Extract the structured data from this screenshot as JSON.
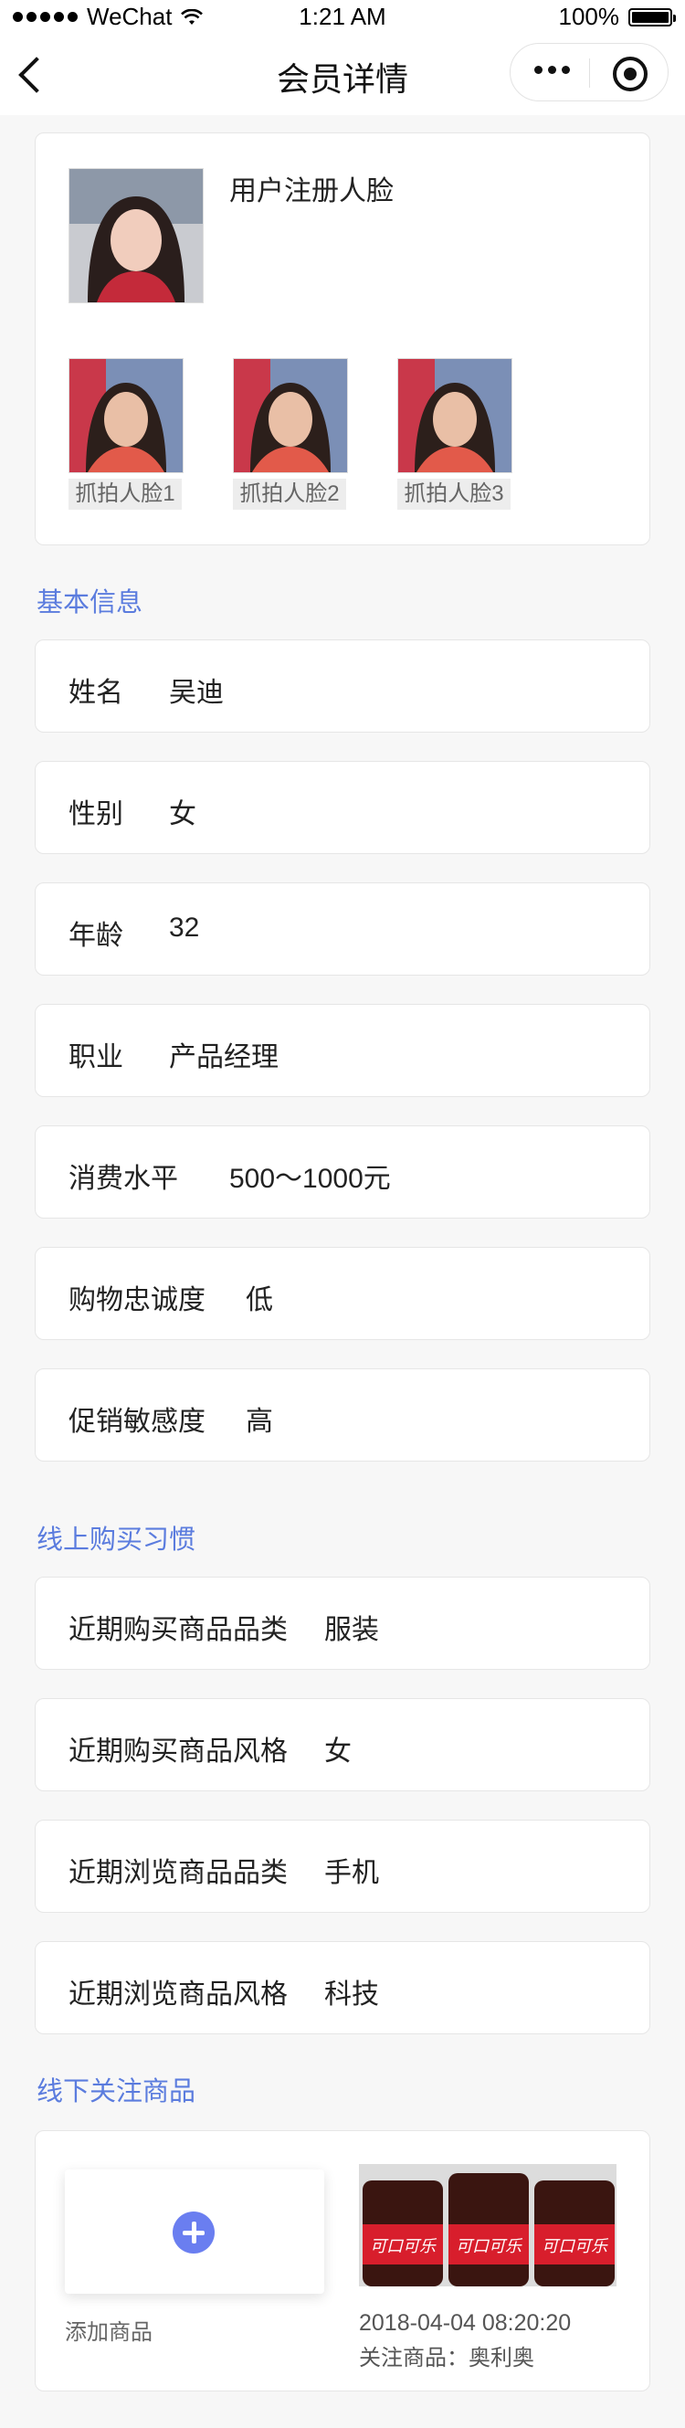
{
  "status": {
    "carrier": "WeChat",
    "time": "1:21 AM",
    "battery": "100%",
    "battery_level": 1.0
  },
  "nav": {
    "title": "会员详情"
  },
  "faces": {
    "register_label": "用户注册人脸",
    "captures": [
      {
        "label": "抓拍人脸1"
      },
      {
        "label": "抓拍人脸2"
      },
      {
        "label": "抓拍人脸3"
      }
    ]
  },
  "basic": {
    "title": "基本信息",
    "rows": [
      {
        "key": "姓名",
        "value": "吴迪"
      },
      {
        "key": "性别",
        "value": "女"
      },
      {
        "key": "年龄",
        "value": "32"
      },
      {
        "key": "职业",
        "value": "产品经理"
      },
      {
        "key": "消费水平",
        "value": "500～1000元"
      },
      {
        "key": "购物忠诚度",
        "value": "低"
      },
      {
        "key": "促销敏感度",
        "value": "高"
      }
    ]
  },
  "online": {
    "title": "线上购买习惯",
    "rows": [
      {
        "key": "近期购买商品品类",
        "value": "服装"
      },
      {
        "key": "近期购买商品风格",
        "value": "女"
      },
      {
        "key": "近期浏览商品品类",
        "value": "手机"
      },
      {
        "key": "近期浏览商品风格",
        "value": "科技"
      }
    ]
  },
  "offline": {
    "title": "线下关注商品",
    "add_label": "添加商品",
    "product": {
      "bottle_text": "可口可乐",
      "time": "2018-04-04 08:20:20",
      "follow": "关注商品：奥利奥"
    }
  },
  "colors": {
    "accent": "#5b7cde",
    "add_button": "#6a7ef0"
  }
}
